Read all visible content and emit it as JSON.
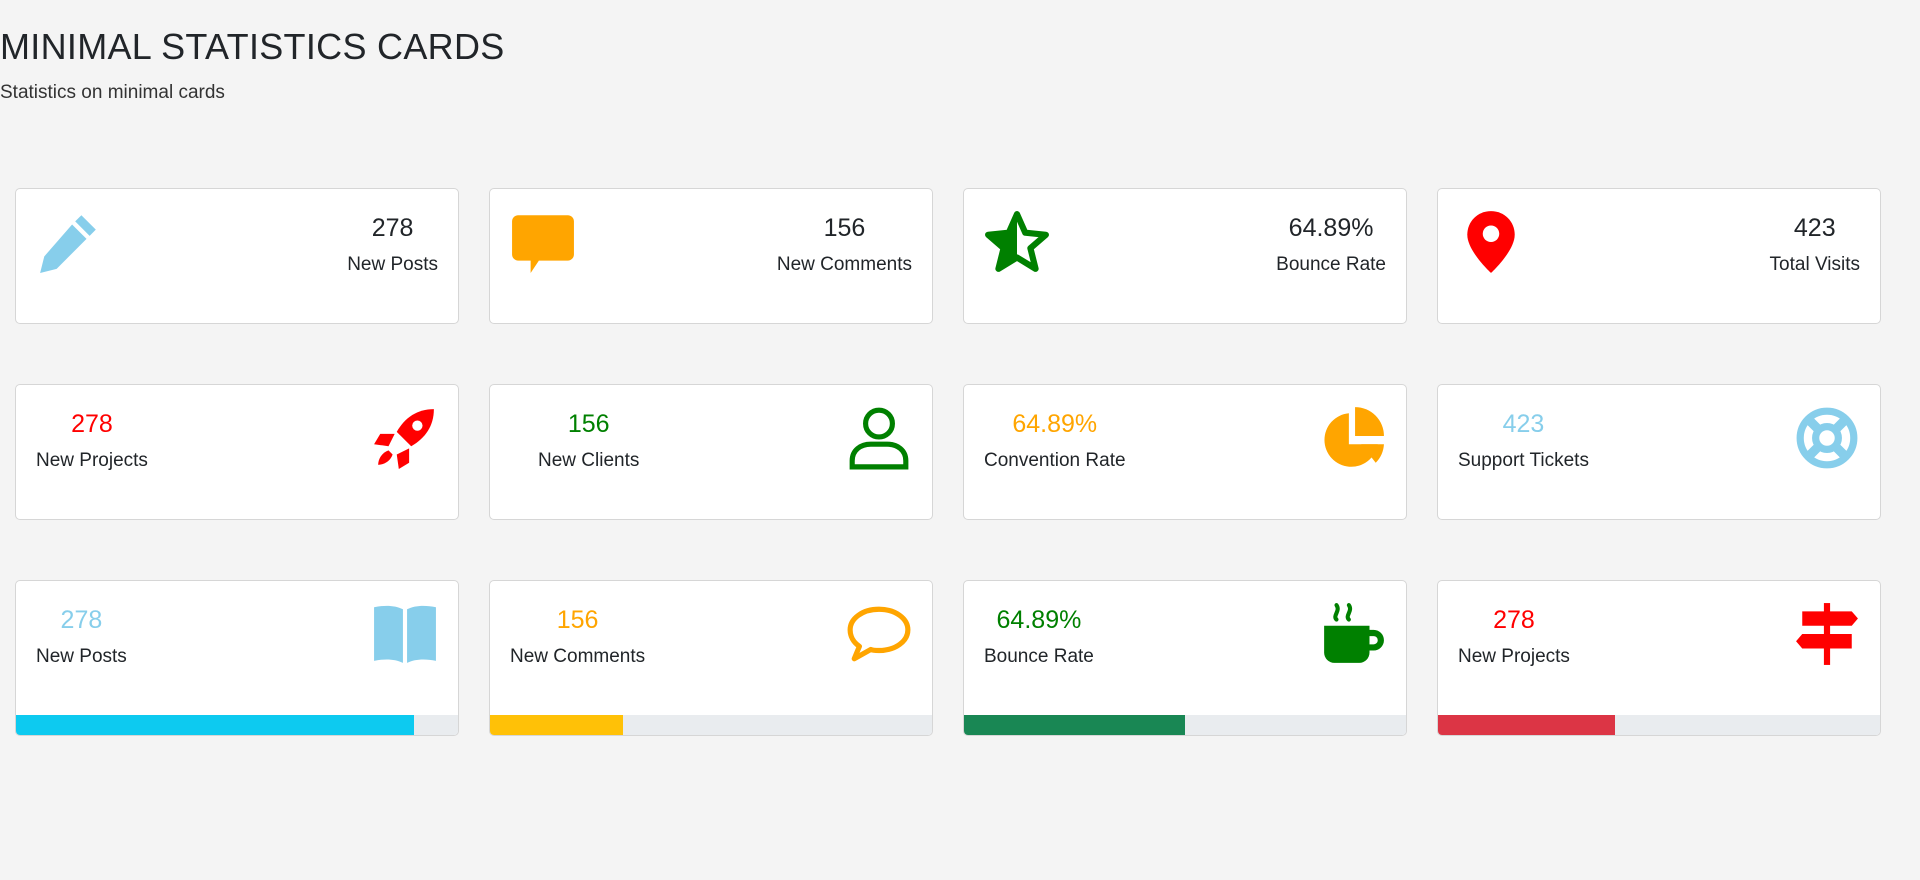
{
  "header": {
    "title": "MINIMAL STATISTICS CARDS",
    "subtitle": "Statistics on minimal cards"
  },
  "row1": [
    {
      "icon": "pencil-icon",
      "color": "#87ceeb",
      "value": "278",
      "label": "New Posts"
    },
    {
      "icon": "speech-bubble-icon",
      "color": "#ffa500",
      "value": "156",
      "label": "New Comments"
    },
    {
      "icon": "star-half-icon",
      "color": "#008000",
      "value": "64.89%",
      "label": "Bounce Rate"
    },
    {
      "icon": "map-marker-icon",
      "color": "#ff0000",
      "value": "423",
      "label": "Total Visits"
    }
  ],
  "row2": [
    {
      "icon": "rocket-icon",
      "color": "#ff0000",
      "value": "278",
      "label": "New Projects"
    },
    {
      "icon": "user-icon",
      "color": "#008000",
      "value": "156",
      "label": "New Clients"
    },
    {
      "icon": "pie-chart-icon",
      "color": "#ffa500",
      "value": "64.89%",
      "label": "Convention Rate"
    },
    {
      "icon": "life-ring-icon",
      "color": "#87ceeb",
      "value": "423",
      "label": "Support Tickets"
    }
  ],
  "row3": [
    {
      "icon": "book-open-icon",
      "color": "#87ceeb",
      "value": "278",
      "label": "New Posts",
      "bar_color": "#0dcaf0",
      "progress": 0.9
    },
    {
      "icon": "comment-outline-icon",
      "color": "#ffa500",
      "value": "156",
      "label": "New Comments",
      "bar_color": "#ffc107",
      "progress": 0.3
    },
    {
      "icon": "coffee-cup-icon",
      "color": "#008000",
      "value": "64.89%",
      "label": "Bounce Rate",
      "bar_color": "#198754",
      "progress": 0.5
    },
    {
      "icon": "signpost-icon",
      "color": "#ff0000",
      "value": "278",
      "label": "New Projects",
      "bar_color": "#dc3545",
      "progress": 0.4
    }
  ]
}
